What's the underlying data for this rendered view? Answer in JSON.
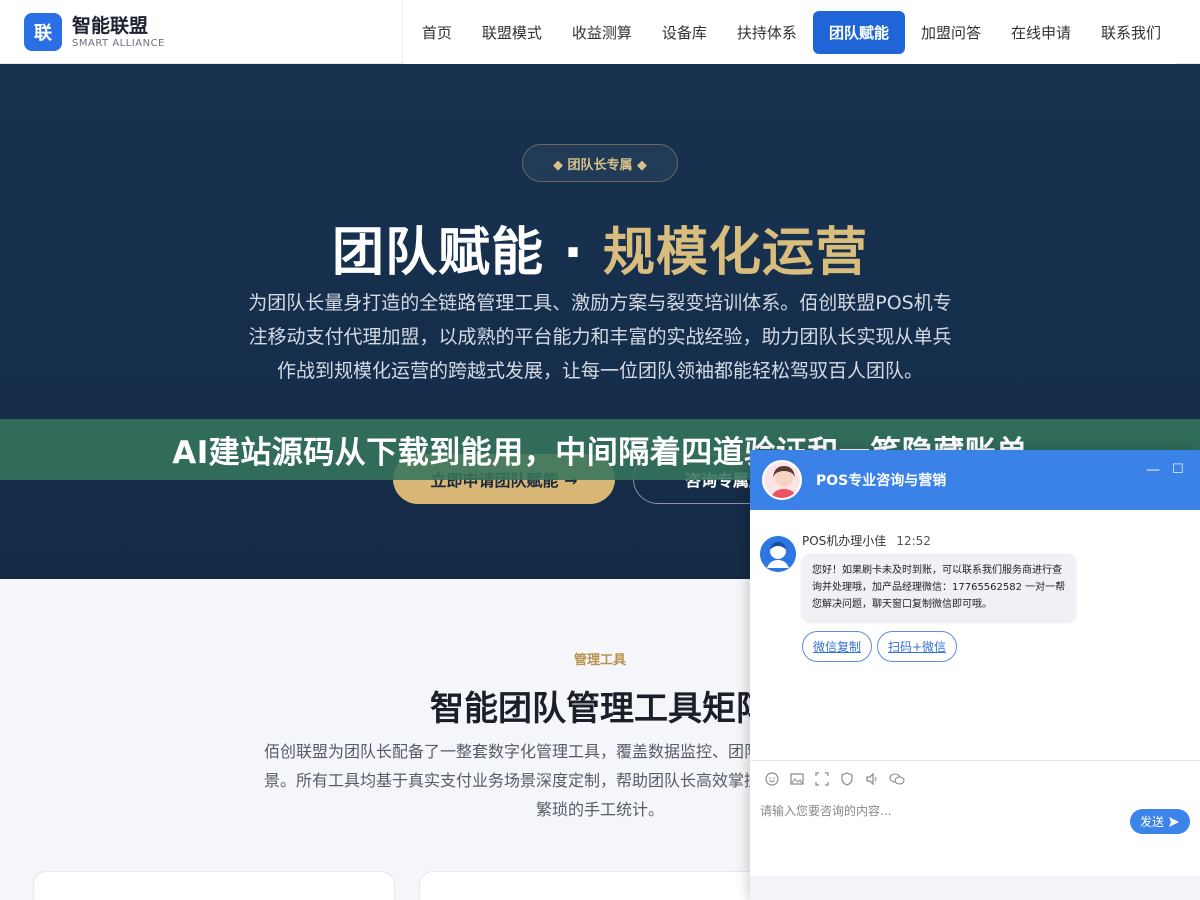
{
  "header": {
    "logo_badge": "联",
    "logo_name": "智能联盟",
    "logo_sub": "SMART ALLIANCE",
    "nav": [
      {
        "label": "首页"
      },
      {
        "label": "联盟模式"
      },
      {
        "label": "收益测算"
      },
      {
        "label": "设备库"
      },
      {
        "label": "扶持体系"
      },
      {
        "label": "团队赋能",
        "active": true
      },
      {
        "label": "加盟问答"
      },
      {
        "label": "在线申请"
      },
      {
        "label": "联系我们"
      }
    ]
  },
  "hero": {
    "badge": "◆ 团队长专属 ◆",
    "title_white": "团队赋能 · ",
    "title_gold": "规模化运营",
    "desc": "为团队长量身打造的全链路管理工具、激励方案与裂变培训体系。佰创联盟POS机专注移动支付代理加盟，以成熟的平台能力和丰富的实战经验，助力团队长实现从单兵作战到规模化运营的跨越式发展，让每一位团队领袖都能轻松驾驭百人团队。",
    "btn_primary": "立即申请团队赋能 →",
    "btn_secondary": "咨询专属顾问"
  },
  "banner": {
    "text": "AI建站源码从下载到能用，中间隔着四道验证和一笔隐藏账单"
  },
  "tools_section": {
    "tag": "管理工具",
    "title": "智能团队管理工具矩阵",
    "desc": "佰创联盟为团队长配备了一整套数字化管理工具，覆盖数据监控、团队管理、分润结算等核心场景。所有工具均基于真实支付业务场景深度定制，帮助团队长高效掌控团队运营全局，彻底告别繁琐的手工统计。"
  },
  "chat": {
    "title": "POS专业咨询与营销",
    "min_icon": "—",
    "max_icon": "☐",
    "agent_name": "POS机办理小佳",
    "time": "12:52",
    "message": "您好！如果刷卡未及时到账，可以联系我们服务商进行查询并处理哦，加产品经理微信：17765562582 一对一帮您解决问题，聊天窗口复制微信即可哦。",
    "quick_buttons": [
      "微信复制",
      "扫码+微信"
    ],
    "placeholder": "请输入您要咨询的内容...",
    "send_label": "发送",
    "accent": "#3b82e8"
  },
  "colors": {
    "brand_blue": "#2065d8",
    "hero_bg": "#17324f",
    "gold": "#d9bd7d",
    "banner_green": "#36745c"
  }
}
